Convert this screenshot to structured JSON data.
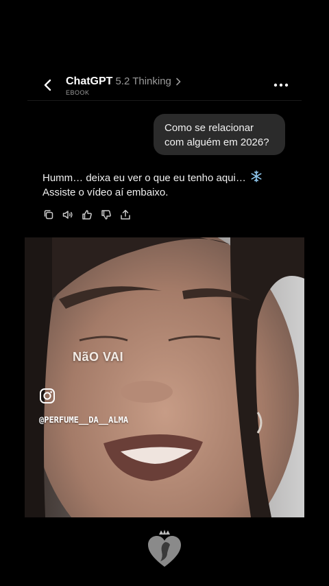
{
  "header": {
    "app_name": "ChatGPT",
    "model": "5.2 Thinking",
    "subtitle": "EBOOK",
    "icons": {
      "back": "chevron-left-icon",
      "model_menu": "chevron-right-icon",
      "more": "ellipsis-icon"
    }
  },
  "conversation": {
    "user_message_line1": "Como se relacionar",
    "user_message_line2": "com alguém em 2026?",
    "assistant_line1": "Humm… deixa eu ver o que eu tenho aqui…",
    "assistant_line2": "Assiste o vídeo aí embaixo.",
    "assistant_emoji": "snowflake-icon",
    "action_icons": [
      "copy-icon",
      "speaker-icon",
      "thumbs-up-icon",
      "thumbs-down-icon",
      "share-icon"
    ]
  },
  "video": {
    "caption": "NãO VAI",
    "social_icon": "instagram-icon",
    "handle": "@PERFUME__DA__ALMA"
  },
  "watermark_icon": "crowned-heart-logo-icon",
  "colors": {
    "background": "#000000",
    "bubble": "#2b2b2b",
    "muted": "#9b9b9b"
  }
}
